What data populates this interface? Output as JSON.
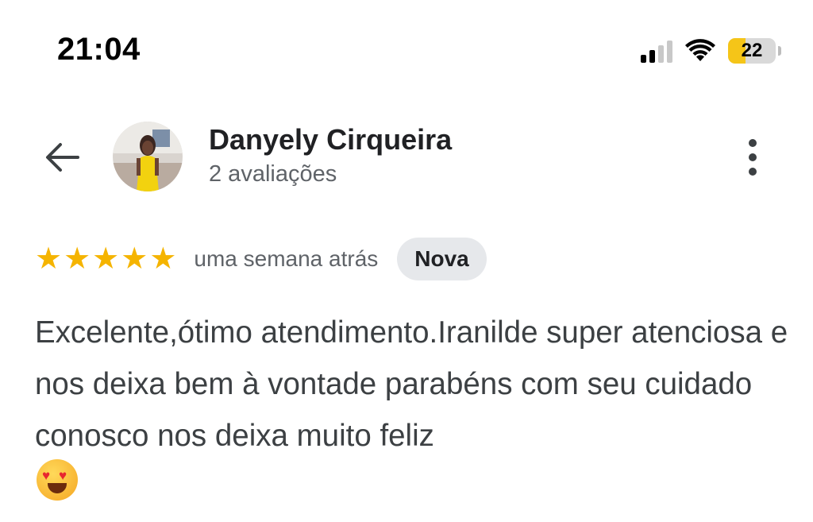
{
  "status_bar": {
    "time": "21:04",
    "battery_level": "22",
    "signal_bars_active": 2,
    "signal_bars_total": 4,
    "colors": {
      "battery_fill": "#f5c518"
    }
  },
  "header": {
    "back_icon": "arrow-left-icon",
    "name": "Danyely Cirqueira",
    "review_count": "2 avaliações",
    "more_icon": "more-vertical-icon"
  },
  "review": {
    "rating": 5,
    "rating_max": 5,
    "star_icon": "star-icon",
    "time_ago": "uma semana atrás",
    "badge": "Nova",
    "text": "Excelente,ótimo atendimento.Iranilde super atenciosa e nos deixa bem à vontade parabéns com seu cuidado conosco nos deixa muito feliz",
    "emoji": "smiling-face-with-heart-eyes-emoji",
    "colors": {
      "star": "#f5b400",
      "badge_bg": "#e6e8eb"
    }
  }
}
